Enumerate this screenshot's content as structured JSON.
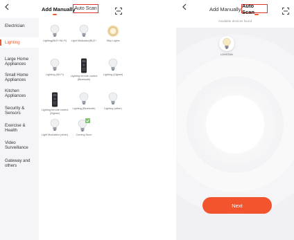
{
  "left": {
    "back_icon": "chevron-left-icon",
    "tab_manual": "Add Manually",
    "tab_auto": "Auto Scan",
    "scan_icon": "scan-frame-icon",
    "accent": "#ee5a2e",
    "sidebar": {
      "items": [
        {
          "label": "Electrician",
          "active": false
        },
        {
          "label": "Lighting",
          "active": true
        },
        {
          "label": "Large Home Appliances",
          "active": false
        },
        {
          "label": "Small Home Appliances",
          "active": false
        },
        {
          "label": "Kitchen Appliances",
          "active": false
        },
        {
          "label": "Security & Sensors",
          "active": false
        },
        {
          "label": "Exercise & Health",
          "active": false
        },
        {
          "label": "Video Surveillance",
          "active": false
        },
        {
          "label": "Gateway and others",
          "active": false
        }
      ]
    },
    "devices": [
      {
        "label": "Lighting(BLE+Wi-Fi)",
        "icon": "bulb-icon"
      },
      {
        "label": "Light Modulator(BLE+",
        "icon": "bulb-icon"
      },
      {
        "label": "Strip Lights",
        "icon": "strip-light-icon"
      },
      {
        "label": "Lighting (Wi-Fi)",
        "icon": "bulb-icon"
      },
      {
        "label": "Lighting remote control (Bluetooth)",
        "icon": "remote-icon"
      },
      {
        "label": "Lighting (Zigbee)",
        "icon": "bulb-icon"
      },
      {
        "label": "Lighting remote control (Zigbee)",
        "icon": "remote-icon"
      },
      {
        "label": "Lighting (Bluetooth)",
        "icon": "bulb-icon"
      },
      {
        "label": "Lighting (other)",
        "icon": "bulb-icon"
      },
      {
        "label": "Light Modulator (other)",
        "icon": "bulb-icon"
      },
      {
        "label": "Coming Soon",
        "icon": "bulb-badge-icon"
      }
    ]
  },
  "right": {
    "back_icon": "chevron-left-icon",
    "tab_manual": "Add Manually",
    "tab_auto": "Auto Scan",
    "scan_icon": "scan-frame-icon",
    "found_text": "Available devices found",
    "device_name": "LDHSTAN",
    "next_label": "Next",
    "button_color": "#f2542d"
  }
}
